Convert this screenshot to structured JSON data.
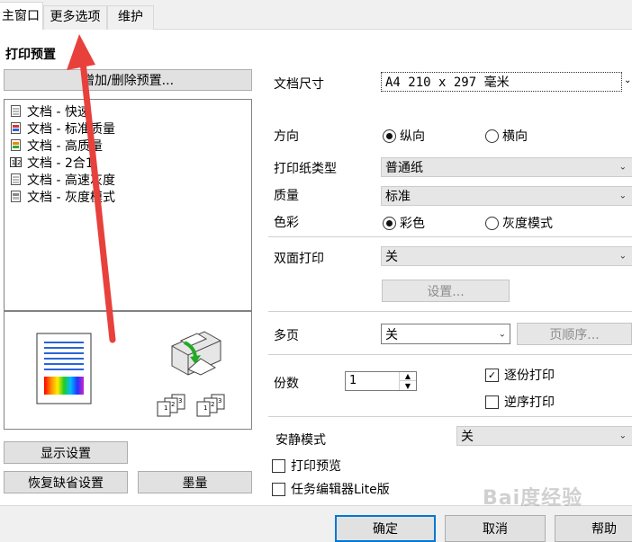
{
  "tabs": [
    {
      "label": "主窗口",
      "active": true
    },
    {
      "label": "更多选项",
      "active": false
    },
    {
      "label": "维护",
      "active": false
    }
  ],
  "presets": {
    "title": "打印预置",
    "add_delete_button": "增加/删除预置...",
    "items": [
      {
        "label": "文档 - 快速",
        "icon": "document-icon"
      },
      {
        "label": "文档 - 标准质量",
        "icon": "document-color-icon"
      },
      {
        "label": "文档 - 高质量",
        "icon": "document-color-icon"
      },
      {
        "label": "文档 - 2合1",
        "icon": "two-in-one-icon"
      },
      {
        "label": "文档 - 高速灰度",
        "icon": "document-icon"
      },
      {
        "label": "文档 - 灰度模式",
        "icon": "document-gray-icon"
      }
    ]
  },
  "left_buttons": {
    "show_settings": "显示设置",
    "restore_defaults": "恢复缺省设置",
    "ink_levels": "墨量"
  },
  "settings": {
    "doc_size_label": "文档尺寸",
    "doc_size_value": "A4 210 x 297 毫米",
    "orientation_label": "方向",
    "orientation_portrait": "纵向",
    "orientation_landscape": "横向",
    "paper_type_label": "打印纸类型",
    "paper_type_value": "普通纸",
    "quality_label": "质量",
    "quality_value": "标准",
    "color_label": "色彩",
    "color_color": "彩色",
    "color_gray": "灰度模式",
    "duplex_label": "双面打印",
    "duplex_value": "关",
    "duplex_settings_button": "设置...",
    "multipage_label": "多页",
    "multipage_value": "关",
    "page_order_button": "页顺序...",
    "copies_label": "份数",
    "copies_value": "1",
    "collate_label": "逐份打印",
    "reverse_label": "逆序打印",
    "quiet_mode_label": "安静模式",
    "quiet_mode_value": "关",
    "print_preview_label": "打印预览",
    "job_editor_label": "任务编辑器Lite版"
  },
  "bottom_buttons": {
    "ok": "确定",
    "cancel": "取消",
    "help": "帮助"
  },
  "watermark": "Bai度经验",
  "colors": {
    "accent": "#0078d7",
    "arrow": "#e8413c"
  }
}
